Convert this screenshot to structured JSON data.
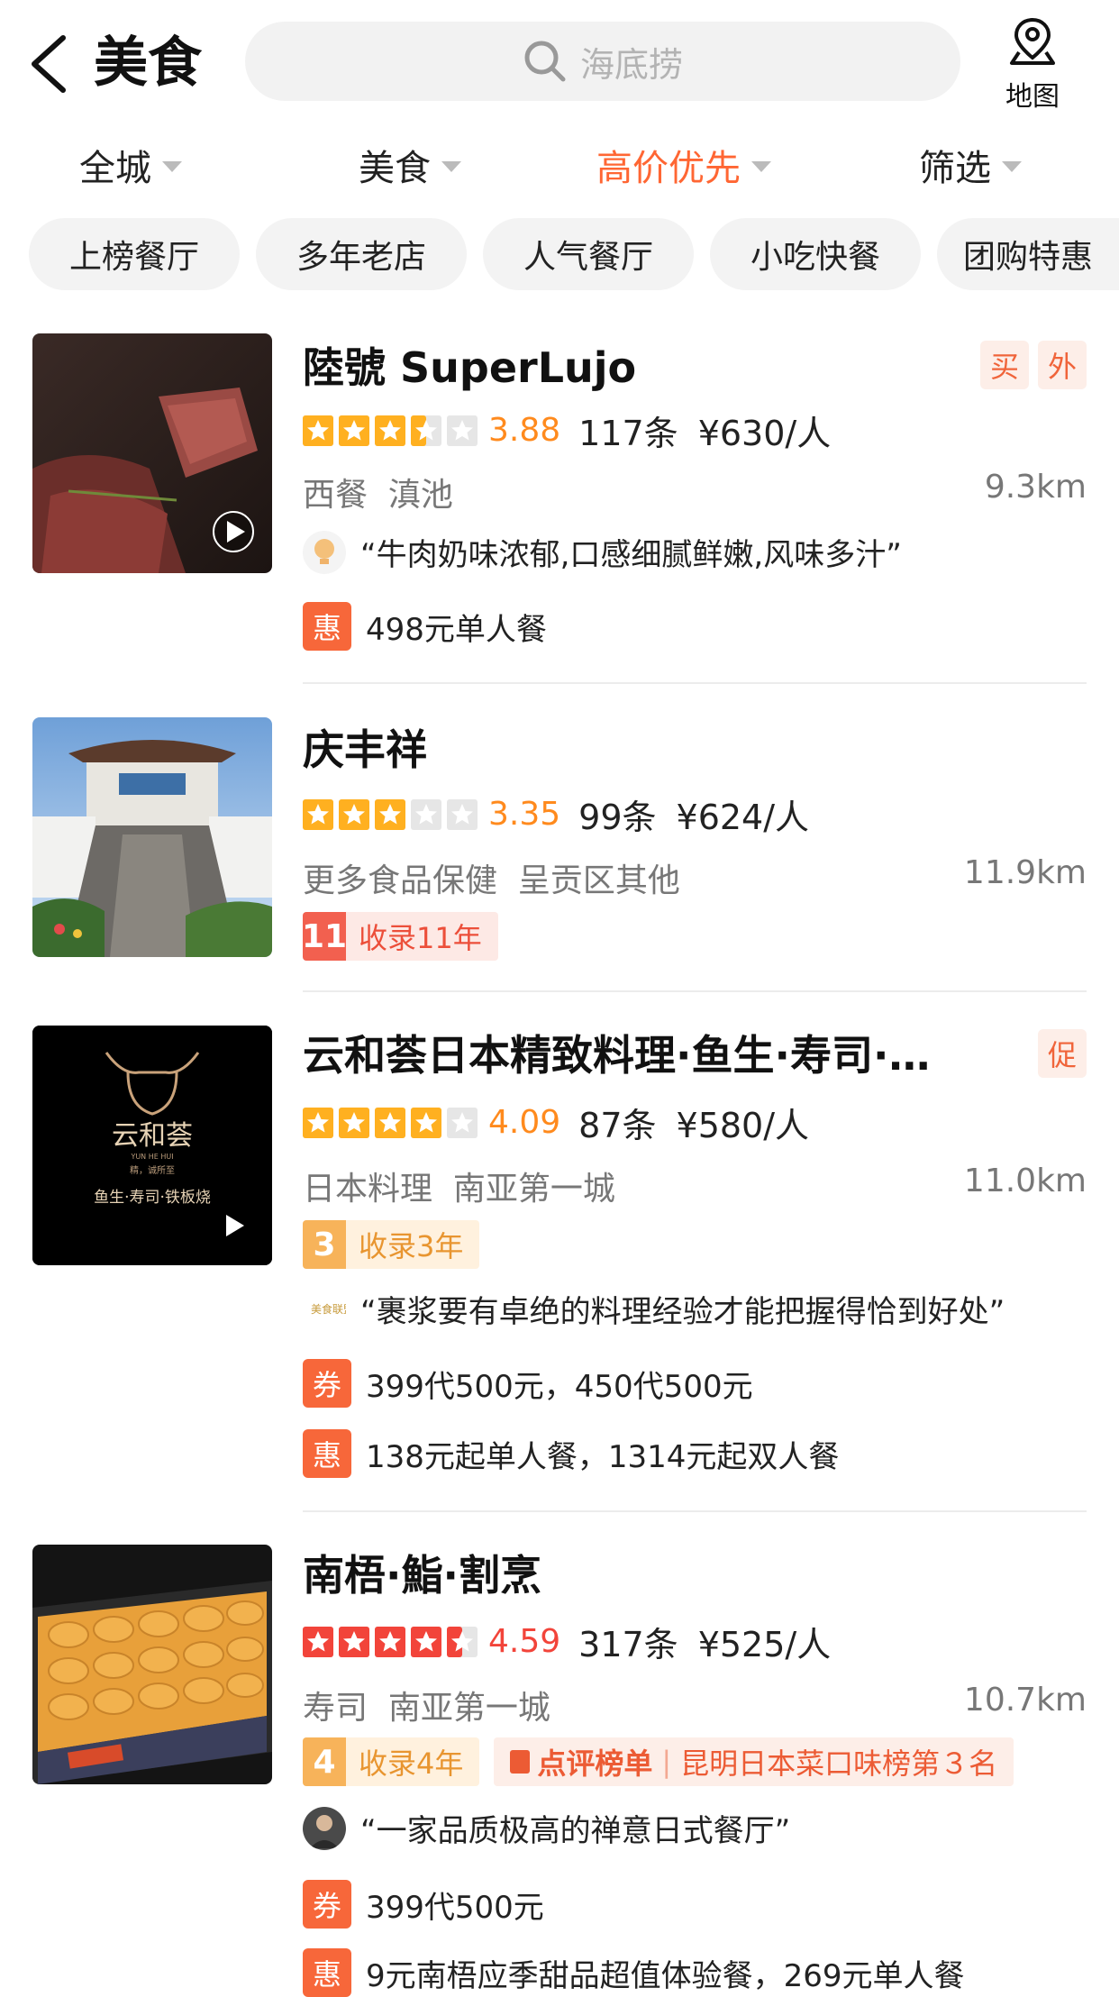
{
  "header": {
    "title": "美食",
    "search_placeholder": "海底捞",
    "map_label": "地图"
  },
  "filters": [
    {
      "label": "全城",
      "active": false
    },
    {
      "label": "美食",
      "active": false
    },
    {
      "label": "高价优先",
      "active": true
    },
    {
      "label": "筛选",
      "active": false
    }
  ],
  "chips": [
    "上榜餐厅",
    "多年老店",
    "人气餐厅",
    "小吃快餐",
    "团购特惠"
  ],
  "colors": {
    "accent": "#ff6633",
    "star": "#ffb020",
    "score": "#ff8a1d"
  },
  "restaurants": [
    {
      "name": "陸號 SuperLujo",
      "badges": [
        "买",
        "外"
      ],
      "rating": 3.5,
      "score": "3.88",
      "reviews": "117条",
      "price": "¥630/人",
      "category": "西餐",
      "area": "滇池",
      "distance": "9.3km",
      "quote": "“牛肉奶味浓郁,口感细腻鲜嫩,风味多汁”",
      "deal_tag": "惠",
      "deal": "498元单人餐"
    },
    {
      "name": "庆丰祥",
      "rating": 3,
      "score": "3.35",
      "reviews": "99条",
      "price": "¥624/人",
      "category": "更多食品保健",
      "area": "呈贡区其他",
      "distance": "11.9km",
      "year_num": "11",
      "year_text": "收录11年"
    },
    {
      "name": "云和荟日本精致料理·鱼生·寿司·…",
      "badges": [
        "促"
      ],
      "rating": 4,
      "score": "4.09",
      "reviews": "87条",
      "price": "¥580/人",
      "category": "日本料理",
      "area": "南亚第一城",
      "distance": "11.0km",
      "year_num": "3",
      "year_text": "收录3年",
      "quote": "“裹浆要有卓绝的料理经验才能把握得恰到好处”",
      "quote_icon_text": "美食联盟",
      "coupon_tag": "券",
      "coupon": "399代500元，450代500元",
      "deal_tag": "惠",
      "deal": "138元起单人餐，1314元起双人餐",
      "logo_text": {
        "brand": "云和荟",
        "sub": "YUN HE HUI",
        "slogan": "精，诚所至",
        "menu": "鱼生·寿司·铁板烧"
      }
    },
    {
      "name": "南梧·鮨·割烹",
      "rating": 4.5,
      "score": "4.59",
      "reviews": "317条",
      "price": "¥525/人",
      "category": "寿司",
      "area": "南亚第一城",
      "distance": "10.7km",
      "year_num": "4",
      "year_text": "收录4年",
      "rank_label": "点评榜单",
      "rank_text": "昆明日本菜口味榜第３名",
      "quote": "“一家品质极高的禅意日式餐厅”",
      "coupon_tag": "券",
      "coupon": "399代500元",
      "deal_tag": "惠",
      "deal": "9元南梧应季甜品超值体验餐，269元单人餐"
    }
  ]
}
